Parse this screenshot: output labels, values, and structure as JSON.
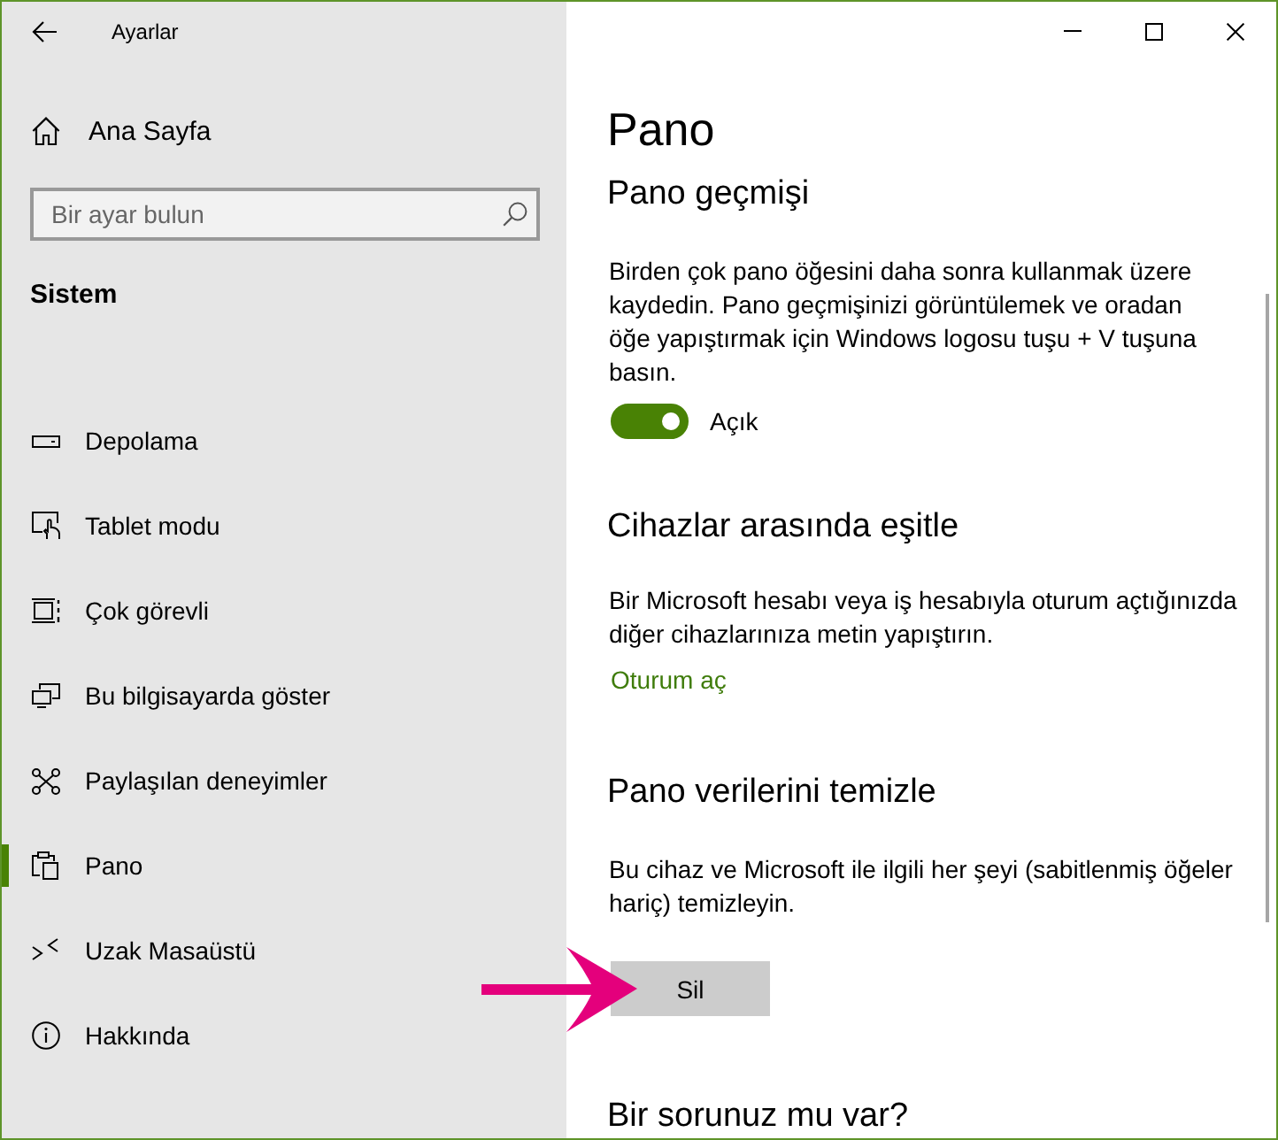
{
  "window": {
    "title": "Ayarlar"
  },
  "sidebar": {
    "home": "Ana Sayfa",
    "search": {
      "placeholder": "Bir ayar bulun"
    },
    "section": "Sistem",
    "items": [
      {
        "label": "Depolama",
        "kind": "storage",
        "selected": false
      },
      {
        "label": "Tablet modu",
        "kind": "tablet",
        "selected": false
      },
      {
        "label": "Çok görevli",
        "kind": "multitasking",
        "selected": false
      },
      {
        "label": "Bu bilgisayarda göster",
        "kind": "projecting",
        "selected": false
      },
      {
        "label": "Paylaşılan deneyimler",
        "kind": "shared",
        "selected": false
      },
      {
        "label": "Pano",
        "kind": "clipboard",
        "selected": true
      },
      {
        "label": "Uzak Masaüstü",
        "kind": "remote",
        "selected": false
      },
      {
        "label": "Hakkında",
        "kind": "about",
        "selected": false
      }
    ]
  },
  "page": {
    "title": "Pano",
    "sections": [
      {
        "heading": "Pano geçmişi",
        "text": "Birden çok pano öğesini daha sonra kullanmak üzere kaydedin. Pano geçmişinizi görüntülemek ve oradan öğe yapıştırmak için Windows logosu tuşu + V tuşuna basın.",
        "toggle": {
          "on": true,
          "label": "Açık"
        }
      },
      {
        "heading": "Cihazlar arasında eşitle",
        "text": "Bir Microsoft hesabı veya iş hesabıyla oturum açtığınızda diğer cihazlarınıza metin yapıştırın.",
        "link": "Oturum aç"
      },
      {
        "heading": "Pano verilerini temizle",
        "text": "Bu cihaz ve Microsoft ile ilgili her şeyi (sabitlenmiş öğeler hariç) temizleyin.",
        "button": "Sil"
      },
      {
        "heading": "Bir sorunuz mu var?"
      }
    ]
  }
}
